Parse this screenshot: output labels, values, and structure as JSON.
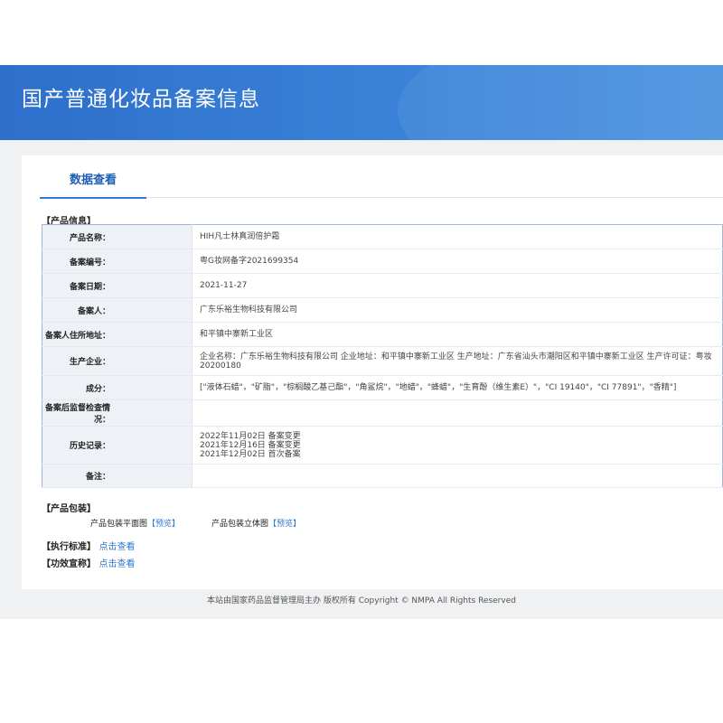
{
  "header": {
    "title": "国产普通化妆品备案信息"
  },
  "tabs": [
    {
      "label": "数据查看"
    }
  ],
  "product_info": {
    "section_label": "【产品信息】",
    "rows": [
      {
        "key": "产品名称：",
        "value": "HIH凡士林真润倍护霜"
      },
      {
        "key": "备案编号：",
        "value": "粤G妆网备字2021699354"
      },
      {
        "key": "备案日期：",
        "value": "2021-11-27"
      },
      {
        "key": "备案人：",
        "value": "广东乐裕生物科技有限公司"
      },
      {
        "key": "备案人住所地址：",
        "value": "和平镇中寨新工业区"
      },
      {
        "key": "生产企业：",
        "value": "企业名称：广东乐裕生物科技有限公司 企业地址：和平镇中寨新工业区 生产地址：广东省汕头市潮阳区和平镇中寨新工业区 生产许可证：粤妆20200180"
      },
      {
        "key": "成分：",
        "value": "[\"液体石蜡\"，\"矿脂\"，\"棕榈酸乙基己酯\"，\"角鲨烷\"，\"地蜡\"，\"蜂蜡\"，\"生育酚（维生素E）\"，\"CI 19140\"，\"CI 77891\"，\"香精\"]"
      },
      {
        "key": "备案后监督检查情况：",
        "value": ""
      },
      {
        "key": "历史记录：",
        "lines": [
          "2022年11月02日 备案变更",
          "2021年12月16日 备案变更",
          "2021年12月02日 首次备案"
        ]
      },
      {
        "key": "备注：",
        "value": ""
      }
    ]
  },
  "packaging": {
    "section_label": "【产品包装】",
    "flat_label": "产品包装平面图",
    "flat_link": "【预览】",
    "solid_label": "产品包装立体图",
    "solid_link": "【预览】"
  },
  "standard": {
    "label": "【执行标准】",
    "link": "点击查看"
  },
  "efficacy": {
    "label": "【功效宣称】",
    "link": "点击查看"
  },
  "footer": {
    "text": "本站由国家药品监督管理局主办 版权所有 Copyright © NMPA All Rights Reserved"
  },
  "colors": {
    "header_blue": "#2d6fcb",
    "link_blue": "#2f79d0",
    "tab_blue": "#1f5fb3"
  }
}
